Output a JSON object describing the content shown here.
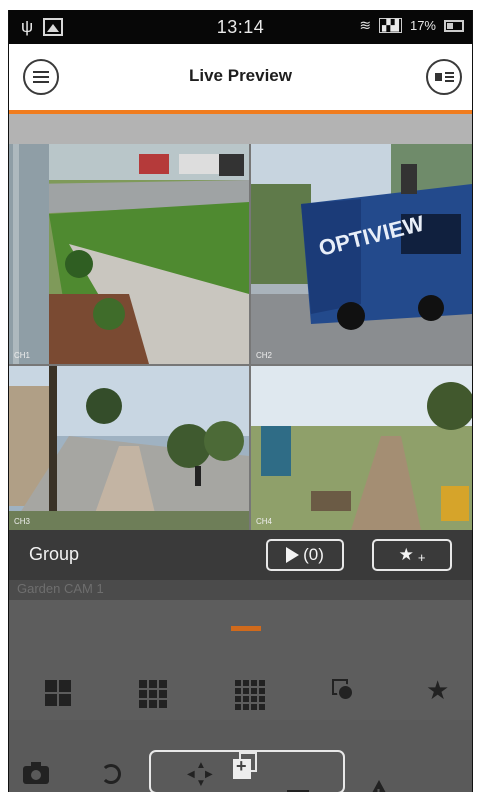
{
  "status_bar": {
    "time": "13:14",
    "battery": "17%",
    "icons": [
      "usb-icon",
      "image-icon",
      "wifi-icon",
      "signal-icon",
      "battery-icon"
    ]
  },
  "header": {
    "title": "Live Preview",
    "accent_color": "#f07c1e",
    "left_icon": "menu-icon",
    "right_icon": "channel-list-icon"
  },
  "cameras": [
    {
      "label": "CH1",
      "scene": "lawn-driveway"
    },
    {
      "label": "CH2",
      "scene": "optiview-van",
      "van_text": "OPTIVIEW"
    },
    {
      "label": "CH3",
      "scene": "palm-walkway"
    },
    {
      "label": "CH4",
      "scene": "beach-path"
    }
  ],
  "group_bar": {
    "label": "Group",
    "play_count": "(0)",
    "play_icon": "play-icon",
    "favorite_icon": "star-add-icon",
    "favorite_plus": "+"
  },
  "background_label": "Garden CAM 1",
  "layout_options": [
    "grid-4-icon",
    "grid-9-icon",
    "grid-16-icon",
    "sequence-icon",
    "favorite-star-icon"
  ],
  "toolbar": [
    "snapshot-icon",
    "playback-icon",
    "ptz-icon",
    "add-copy-icon",
    "image-icon",
    "alarm-icon",
    "record-icon"
  ]
}
